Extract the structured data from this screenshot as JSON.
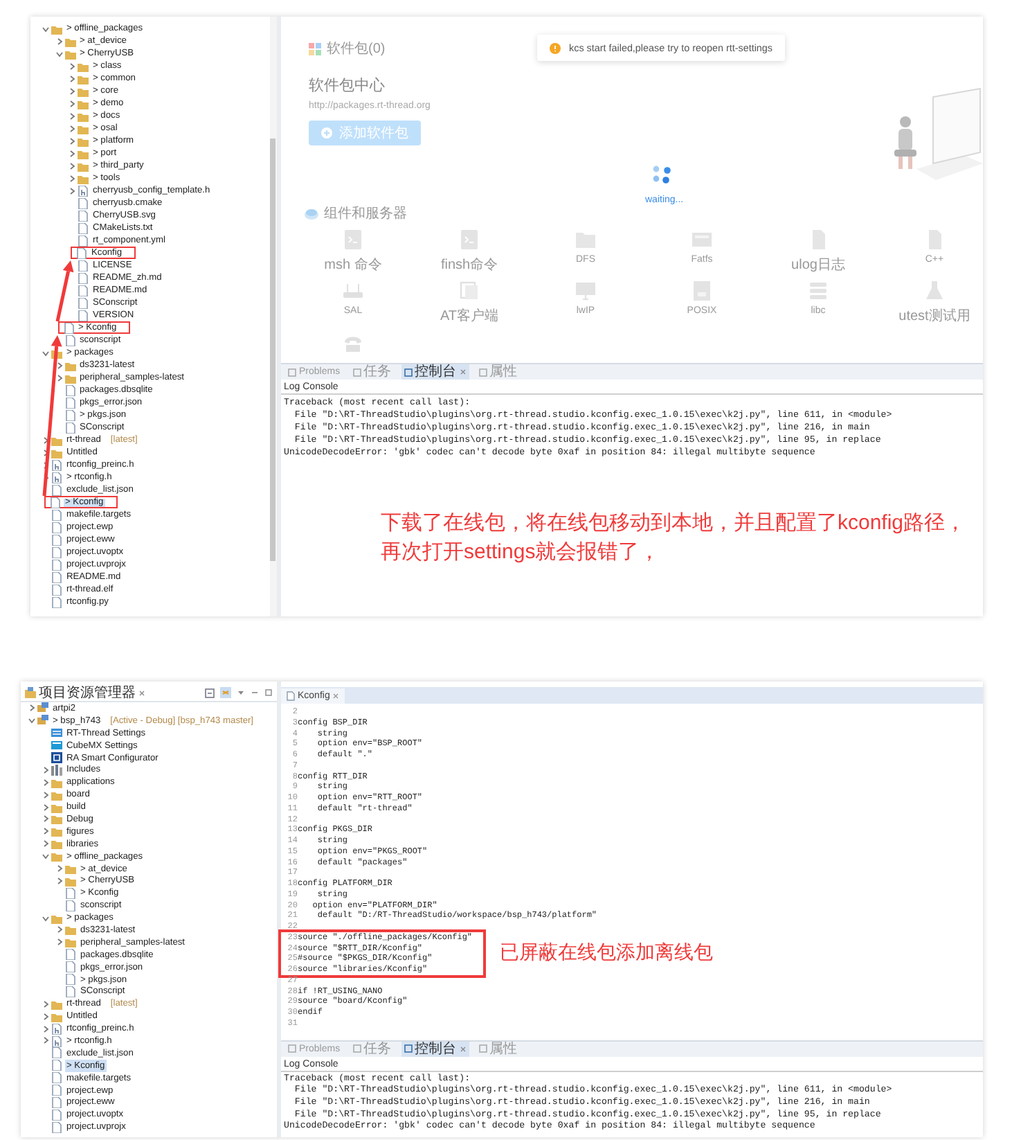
{
  "top_screenshot": {
    "explorer": {
      "items": [
        {
          "label": "> offline_packages",
          "kind": "folder",
          "expanded": true,
          "selected": false,
          "marked": false,
          "children": [
            {
              "label": "> at_device",
              "kind": "folder",
              "expanded": false,
              "selected": false,
              "marked": false
            },
            {
              "label": "> CherryUSB",
              "kind": "folder",
              "expanded": true,
              "selected": false,
              "marked": false,
              "children": [
                {
                  "label": "> class",
                  "kind": "folder",
                  "expanded": false,
                  "selected": false,
                  "marked": false
                },
                {
                  "label": "> common",
                  "kind": "folder",
                  "expanded": false,
                  "selected": false,
                  "marked": false
                },
                {
                  "label": "> core",
                  "kind": "folder",
                  "expanded": false,
                  "selected": false,
                  "marked": false
                },
                {
                  "label": "> demo",
                  "kind": "folder",
                  "expanded": false,
                  "selected": false,
                  "marked": false
                },
                {
                  "label": "> docs",
                  "kind": "folder",
                  "expanded": false,
                  "selected": false,
                  "marked": false
                },
                {
                  "label": "> osal",
                  "kind": "folder",
                  "expanded": false,
                  "selected": false,
                  "marked": false
                },
                {
                  "label": "> platform",
                  "kind": "folder",
                  "expanded": false,
                  "selected": false,
                  "marked": false
                },
                {
                  "label": "> port",
                  "kind": "folder",
                  "expanded": false,
                  "selected": false,
                  "marked": false
                },
                {
                  "label": "> third_party",
                  "kind": "folder",
                  "expanded": false,
                  "selected": false,
                  "marked": false
                },
                {
                  "label": "> tools",
                  "kind": "folder",
                  "expanded": false,
                  "selected": false,
                  "marked": false
                },
                {
                  "label": "cherryusb_config_template.h",
                  "kind": "header",
                  "expanded": false,
                  "selected": false,
                  "marked": false
                },
                {
                  "label": "cherryusb.cmake",
                  "kind": "file",
                  "selected": false,
                  "marked": false
                },
                {
                  "label": "CherryUSB.svg",
                  "kind": "file",
                  "selected": false,
                  "marked": false
                },
                {
                  "label": "CMakeLists.txt",
                  "kind": "file",
                  "selected": false,
                  "marked": false
                },
                {
                  "label": "rt_component.yml",
                  "kind": "file",
                  "selected": false,
                  "marked": false
                },
                {
                  "label": "Kconfig",
                  "kind": "file",
                  "selected": false,
                  "marked": true
                },
                {
                  "label": "LICENSE",
                  "kind": "file",
                  "selected": false,
                  "marked": false
                },
                {
                  "label": "README_zh.md",
                  "kind": "file",
                  "selected": false,
                  "marked": false
                },
                {
                  "label": "README.md",
                  "kind": "file",
                  "selected": false,
                  "marked": false
                },
                {
                  "label": "SConscript",
                  "kind": "file",
                  "selected": false,
                  "marked": false
                },
                {
                  "label": "VERSION",
                  "kind": "file",
                  "selected": false,
                  "marked": false
                }
              ]
            },
            {
              "label": "> Kconfig",
              "kind": "file",
              "selected": false,
              "marked": true
            },
            {
              "label": "sconscript",
              "kind": "file",
              "selected": false,
              "marked": false
            }
          ]
        },
        {
          "label": "> packages",
          "kind": "folder",
          "expanded": true,
          "selected": false,
          "marked": false,
          "children": [
            {
              "label": "ds3231-latest",
              "kind": "folder",
              "expanded": false,
              "selected": false,
              "marked": false
            },
            {
              "label": "peripheral_samples-latest",
              "kind": "folder",
              "expanded": false,
              "selected": false,
              "marked": false
            },
            {
              "label": "packages.dbsqlite",
              "kind": "file",
              "selected": false,
              "marked": false
            },
            {
              "label": "pkgs_error.json",
              "kind": "file",
              "selected": false,
              "marked": false
            },
            {
              "label": "> pkgs.json",
              "kind": "file",
              "selected": false,
              "marked": false
            },
            {
              "label": "SConscript",
              "kind": "file",
              "selected": false,
              "marked": false
            }
          ]
        },
        {
          "label": "rt-thread",
          "decoration": "[latest]",
          "kind": "folder",
          "expanded": false,
          "selected": false,
          "marked": false
        },
        {
          "label": "Untitled",
          "kind": "folder",
          "expanded": false,
          "selected": false,
          "marked": false
        },
        {
          "label": "rtconfig_preinc.h",
          "kind": "header",
          "expanded": false,
          "selected": false,
          "marked": false
        },
        {
          "label": "> rtconfig.h",
          "kind": "header",
          "expanded": false,
          "selected": false,
          "marked": false
        },
        {
          "label": "exclude_list.json",
          "kind": "file",
          "selected": false,
          "marked": false
        },
        {
          "label": "> Kconfig",
          "kind": "file",
          "selected": true,
          "marked": true
        },
        {
          "label": "makefile.targets",
          "kind": "file",
          "selected": false,
          "marked": false
        },
        {
          "label": "project.ewp",
          "kind": "file",
          "selected": false,
          "marked": false
        },
        {
          "label": "project.eww",
          "kind": "file",
          "selected": false,
          "marked": false
        },
        {
          "label": "project.uvoptx",
          "kind": "file",
          "selected": false,
          "marked": false
        },
        {
          "label": "project.uvprojx",
          "kind": "file",
          "selected": false,
          "marked": false
        },
        {
          "label": "README.md",
          "kind": "file",
          "selected": false,
          "marked": false
        },
        {
          "label": "rt-thread.elf",
          "kind": "file",
          "selected": false,
          "marked": false
        },
        {
          "label": "rtconfig.py",
          "kind": "file",
          "selected": false,
          "marked": false
        }
      ]
    },
    "package_view": {
      "header": "软件包(0)",
      "title": "软件包中心",
      "url": "http://packages.rt-thread.org",
      "add_button": "添加软件包",
      "toast": "kcs start failed,please try to reopen rtt-settings",
      "loading_text": "waiting...",
      "section_title": "组件和服务器",
      "components": [
        {
          "label": "msh 命令",
          "kind": "terminal"
        },
        {
          "label": "finsh命令",
          "kind": "terminal"
        },
        {
          "label": "DFS",
          "kind": "folder"
        },
        {
          "label": "Fatfs",
          "kind": "drive"
        },
        {
          "label": "ulog日志",
          "kind": "document"
        },
        {
          "label": "C++",
          "kind": "document"
        },
        {
          "label": "SAL",
          "kind": "router"
        },
        {
          "label": "AT客户端",
          "kind": "window"
        },
        {
          "label": "lwIP",
          "kind": "monitor"
        },
        {
          "label": "POSIX",
          "kind": "chip"
        },
        {
          "label": "libc",
          "kind": "stack"
        },
        {
          "label": "utest测试用",
          "kind": "flask"
        },
        {
          "kind": "phone"
        }
      ]
    },
    "bottom_tabs": [
      {
        "label": "Problems",
        "selected": false
      },
      {
        "label": "任务",
        "selected": false
      },
      {
        "label": "控制台",
        "selected": true
      },
      {
        "label": "属性",
        "selected": false
      }
    ],
    "console": {
      "title": "Log Console",
      "lines": [
        "Traceback (most recent call last):",
        "  File \"D:\\RT-ThreadStudio\\plugins\\org.rt-thread.studio.kconfig.exec_1.0.15\\exec\\k2j.py\", line 611, in <module>",
        "  File \"D:\\RT-ThreadStudio\\plugins\\org.rt-thread.studio.kconfig.exec_1.0.15\\exec\\k2j.py\", line 216, in main",
        "  File \"D:\\RT-ThreadStudio\\plugins\\org.rt-thread.studio.kconfig.exec_1.0.15\\exec\\k2j.py\", line 95, in replace",
        "UnicodeDecodeError: 'gbk' codec can't decode byte 0xaf in position 84: illegal multibyte sequence"
      ]
    },
    "annotation": {
      "lines": [
        "下载了在线包，将在线包移动到本地，并且配置了kconfig路径，",
        "再次打开settings就会报错了，"
      ]
    }
  },
  "bottom_screenshot": {
    "explorer": {
      "title": "项目资源管理器",
      "items": [
        {
          "label": "artpi2",
          "kind": "project",
          "expanded": false,
          "selected": false
        },
        {
          "label": "> bsp_h743",
          "decoration": "[Active - Debug] [bsp_h743 master]",
          "kind": "project",
          "expanded": true,
          "selected": false,
          "children": [
            {
              "label": "RT-Thread Settings",
              "kind": "settings",
              "selected": false
            },
            {
              "label": "CubeMX Settings",
              "kind": "cube",
              "selected": false
            },
            {
              "label": "RA Smart Configurator",
              "kind": "configurator",
              "selected": false
            },
            {
              "label": "Includes",
              "kind": "includes",
              "expanded": false,
              "selected": false
            },
            {
              "label": "applications",
              "kind": "folder",
              "expanded": false,
              "selected": false
            },
            {
              "label": "board",
              "kind": "folder",
              "expanded": false,
              "selected": false
            },
            {
              "label": "build",
              "kind": "folder",
              "expanded": false,
              "selected": false
            },
            {
              "label": "Debug",
              "kind": "folder",
              "expanded": false,
              "selected": false
            },
            {
              "label": "figures",
              "kind": "folder",
              "expanded": false,
              "selected": false
            },
            {
              "label": "libraries",
              "kind": "folder",
              "expanded": false,
              "selected": false
            },
            {
              "label": "> offline_packages",
              "kind": "folder",
              "expanded": true,
              "selected": false,
              "children": [
                {
                  "label": "> at_device",
                  "kind": "folder",
                  "expanded": false,
                  "selected": false
                },
                {
                  "label": "> CherryUSB",
                  "kind": "folder",
                  "expanded": false,
                  "selected": false
                },
                {
                  "label": "> Kconfig",
                  "kind": "file",
                  "selected": false
                },
                {
                  "label": "sconscript",
                  "kind": "file",
                  "selected": false
                }
              ]
            },
            {
              "label": "> packages",
              "kind": "folder",
              "expanded": true,
              "selected": false,
              "children": [
                {
                  "label": "ds3231-latest",
                  "kind": "folder",
                  "expanded": false,
                  "selected": false
                },
                {
                  "label": "peripheral_samples-latest",
                  "kind": "folder",
                  "expanded": false,
                  "selected": false
                },
                {
                  "label": "packages.dbsqlite",
                  "kind": "file",
                  "selected": false
                },
                {
                  "label": "pkgs_error.json",
                  "kind": "file",
                  "selected": false
                },
                {
                  "label": "> pkgs.json",
                  "kind": "file",
                  "selected": false
                },
                {
                  "label": "SConscript",
                  "kind": "file",
                  "selected": false
                }
              ]
            },
            {
              "label": "rt-thread",
              "decoration": "[latest]",
              "kind": "folder",
              "expanded": false,
              "selected": false
            },
            {
              "label": "Untitled",
              "kind": "folder",
              "expanded": false,
              "selected": false
            },
            {
              "label": "rtconfig_preinc.h",
              "kind": "header",
              "expanded": false,
              "selected": false
            },
            {
              "label": "> rtconfig.h",
              "kind": "header",
              "expanded": false,
              "selected": false
            },
            {
              "label": "exclude_list.json",
              "kind": "file",
              "selected": false
            },
            {
              "label": "> Kconfig",
              "kind": "file",
              "selected": true
            },
            {
              "label": "makefile.targets",
              "kind": "file",
              "selected": false
            },
            {
              "label": "project.ewp",
              "kind": "file",
              "selected": false
            },
            {
              "label": "project.eww",
              "kind": "file",
              "selected": false
            },
            {
              "label": "project.uvoptx",
              "kind": "file",
              "selected": false
            },
            {
              "label": "project.uvprojx",
              "kind": "file",
              "selected": false
            }
          ]
        }
      ]
    },
    "editor": {
      "tab": "Kconfig",
      "callout": "已屏蔽在线包添加离线包",
      "lines": [
        {
          "number": "2",
          "marked": false
        },
        {
          "number": "3",
          "text": "config BSP_DIR",
          "marked": false
        },
        {
          "number": "4",
          "text": "    string",
          "marked": false
        },
        {
          "number": "5",
          "text": "    option env=\"BSP_ROOT\"",
          "marked": false
        },
        {
          "number": "6",
          "text": "    default \".\"",
          "marked": false
        },
        {
          "number": "7",
          "marked": false
        },
        {
          "number": "8",
          "text": "config RTT_DIR",
          "marked": false
        },
        {
          "number": "9",
          "text": "    string",
          "marked": false
        },
        {
          "number": "10",
          "text": "    option env=\"RTT_ROOT\"",
          "marked": false
        },
        {
          "number": "11",
          "text": "    default \"rt-thread\"",
          "marked": false
        },
        {
          "number": "12",
          "marked": false
        },
        {
          "number": "13",
          "text": "config PKGS_DIR",
          "marked": false
        },
        {
          "number": "14",
          "text": "    string",
          "marked": false
        },
        {
          "number": "15",
          "text": "    option env=\"PKGS_ROOT\"",
          "marked": false
        },
        {
          "number": "16",
          "text": "    default \"packages\"",
          "marked": false
        },
        {
          "number": "17",
          "marked": false
        },
        {
          "number": "18",
          "text": "config PLATFORM_DIR",
          "marked": false
        },
        {
          "number": "19",
          "text": "    string",
          "marked": false
        },
        {
          "number": "20",
          "text": "   option env=\"PLATFORM_DIR\"",
          "marked": false
        },
        {
          "number": "21",
          "text": "    default \"D:/RT-ThreadStudio/workspace/bsp_h743/platform\"",
          "marked": false
        },
        {
          "number": "22",
          "marked": false
        },
        {
          "number": "23",
          "text": "source \"./offline_packages/Kconfig\"",
          "marked": true
        },
        {
          "number": "24",
          "text": "source \"$RTT_DIR/Kconfig\"",
          "marked": true
        },
        {
          "number": "25",
          "text": "#source \"$PKGS_DIR/Kconfig\"",
          "marked": true
        },
        {
          "number": "26",
          "text": "source \"libraries/Kconfig\"",
          "marked": true
        },
        {
          "number": "27",
          "marked": false
        },
        {
          "number": "28",
          "text": "if !RT_USING_NANO",
          "marked": false
        },
        {
          "number": "29",
          "text": "source \"board/Kconfig\"",
          "marked": false
        },
        {
          "number": "30",
          "text": "endif",
          "marked": false
        },
        {
          "number": "31",
          "marked": false
        }
      ]
    },
    "bottom_tabs": [
      {
        "label": "Problems",
        "selected": false
      },
      {
        "label": "任务",
        "selected": false
      },
      {
        "label": "控制台",
        "selected": true
      },
      {
        "label": "属性",
        "selected": false
      }
    ],
    "console": {
      "title": "Log Console",
      "lines": [
        "Traceback (most recent call last):",
        "  File \"D:\\RT-ThreadStudio\\plugins\\org.rt-thread.studio.kconfig.exec_1.0.15\\exec\\k2j.py\", line 611, in <module>",
        "  File \"D:\\RT-ThreadStudio\\plugins\\org.rt-thread.studio.kconfig.exec_1.0.15\\exec\\k2j.py\", line 216, in main",
        "  File \"D:\\RT-ThreadStudio\\plugins\\org.rt-thread.studio.kconfig.exec_1.0.15\\exec\\k2j.py\", line 95, in replace",
        "UnicodeDecodeError: 'gbk' codec can't decode byte 0xaf in position 84: illegal multibyte sequence"
      ]
    }
  }
}
